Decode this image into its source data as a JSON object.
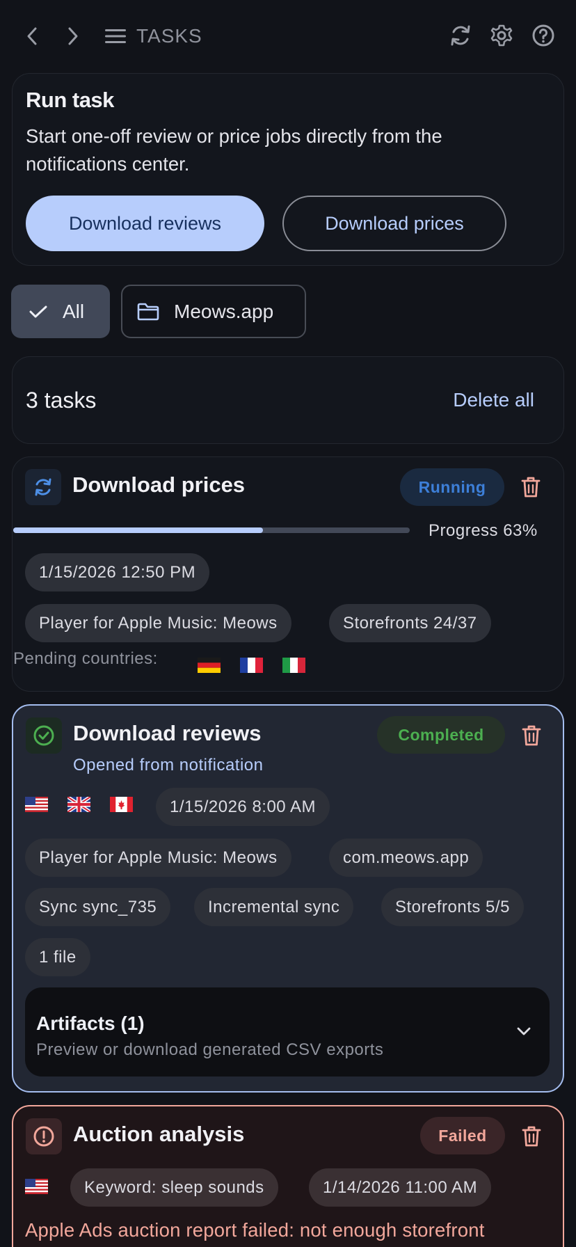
{
  "topbar": {
    "title": "TASKS",
    "icons": [
      "chevron-left-icon",
      "chevron-right-icon",
      "menu-icon",
      "refresh-icon",
      "settings-icon",
      "help-icon"
    ]
  },
  "run_task": {
    "heading": "Run task",
    "description": "Start one-off review or price jobs directly from the notifications center.",
    "primary_button": "Download reviews",
    "secondary_button": "Download prices"
  },
  "filters": {
    "all_label": "All",
    "app_label": "Meows.app",
    "selected": "All"
  },
  "summary": {
    "count_label": "3 tasks",
    "delete_all_label": "Delete all"
  },
  "tasks": [
    {
      "title": "Download prices",
      "status": "Running",
      "progress_label": "Progress 63%",
      "progress_fraction": 0.63,
      "timestamp": "1/15/2026 12:50 PM",
      "tags": [
        "Player for Apple Music: Meows",
        "Storefronts 24/37"
      ],
      "pending_label": "Pending countries:",
      "pending_flags": [
        "DE",
        "FR",
        "IT"
      ]
    },
    {
      "title": "Download reviews",
      "status": "Completed",
      "note": "Opened from notification",
      "flags": [
        "US",
        "GB",
        "CA"
      ],
      "timestamp": "1/15/2026 8:00 AM",
      "tags": [
        "Player for Apple Music: Meows",
        "com.meows.app",
        "Sync sync_735",
        "Incremental sync",
        "Storefronts 5/5",
        "1 file"
      ],
      "artifacts_title": "Artifacts (1)",
      "artifacts_subtitle": "Preview or download generated CSV exports"
    },
    {
      "title": "Auction analysis",
      "status": "Failed",
      "flags": [
        "US"
      ],
      "tags": [
        "Keyword: sleep sounds",
        "1/14/2026 11:00 AM"
      ],
      "error": "Apple Ads auction report failed: not enough storefront"
    }
  ],
  "colors": {
    "background": "#111319",
    "accent": "#b7cdfc",
    "running": "#3d7fd8",
    "completed": "#4caf50",
    "failed": "#f2a79b"
  }
}
